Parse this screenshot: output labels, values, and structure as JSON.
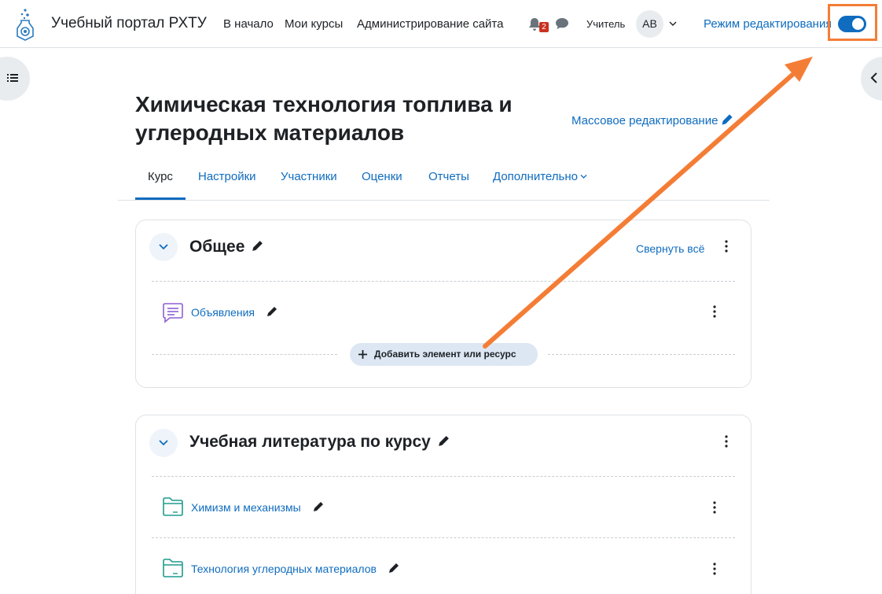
{
  "header": {
    "site_name": "Учебный портал РХТУ",
    "nav": [
      "В начало",
      "Мои курсы",
      "Администрирование сайта"
    ],
    "notifications_count": "2",
    "role": "Учитель",
    "avatar_initials": "АВ",
    "edit_mode_label": "Режим редактирования",
    "edit_mode_on": true
  },
  "page": {
    "title": "Химическая технология топлива и углеродных материалов",
    "bulk_edit": "Массовое редактирование"
  },
  "tabs": [
    {
      "label": "Курс",
      "active": true
    },
    {
      "label": "Настройки"
    },
    {
      "label": "Участники"
    },
    {
      "label": "Оценки"
    },
    {
      "label": "Отчеты"
    },
    {
      "label": "Дополнительно"
    }
  ],
  "sections": [
    {
      "title": "Общее",
      "collapse_all": "Свернуть всё",
      "activities": [
        {
          "name": "Объявления",
          "icon": "forum-icon"
        }
      ],
      "add_button": "Добавить элемент или ресурс"
    },
    {
      "title": "Учебная литература по курсу",
      "activities": [
        {
          "name": "Химизм и механизмы",
          "icon": "folder-icon"
        },
        {
          "name": "Технология углеродных материалов",
          "icon": "folder-icon"
        }
      ]
    }
  ],
  "colors": {
    "accent": "#0f6cbf",
    "highlight": "#f47d36",
    "badge": "#ca3120"
  }
}
